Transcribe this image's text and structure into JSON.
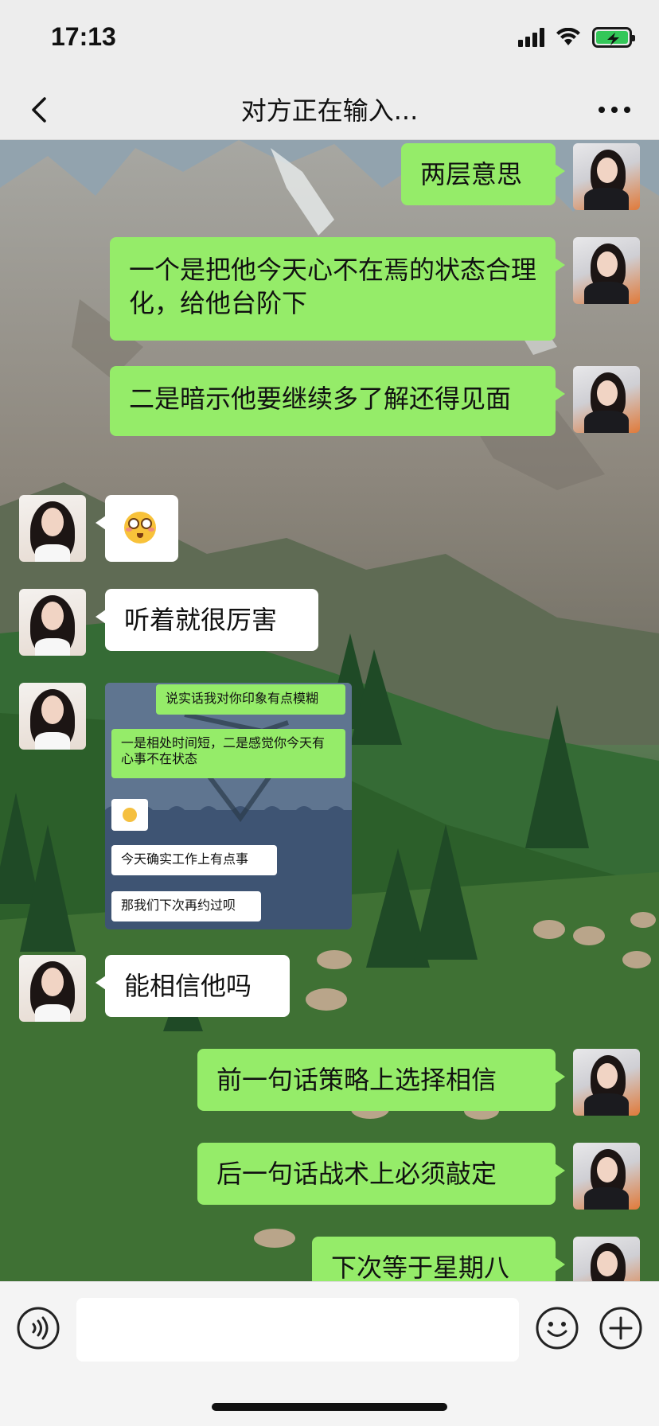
{
  "status_bar": {
    "time": "17:13",
    "icons": [
      "signal-icon",
      "wifi-icon",
      "battery-charging-icon"
    ],
    "battery_color": "#34c759"
  },
  "nav": {
    "back_icon": "chevron-left-icon",
    "title": "对方正在输入...",
    "more_icon": "more-dots-icon"
  },
  "colors": {
    "outgoing_bubble": "#95ec69",
    "incoming_bubble": "#ffffff",
    "bar_background": "#ededed"
  },
  "messages": [
    {
      "direction": "out",
      "type": "text",
      "text": "两层意思"
    },
    {
      "direction": "out",
      "type": "text",
      "text": "一个是把他今天心不在焉的状态合理化，给他台阶下"
    },
    {
      "direction": "out",
      "type": "text",
      "text": "二是暗示他要继续多了解还得见面"
    },
    {
      "direction": "in",
      "type": "emoji",
      "emoji": "pleading-face-emoji"
    },
    {
      "direction": "in",
      "type": "text",
      "text": "听着就很厉害"
    },
    {
      "direction": "in",
      "type": "image",
      "embedded": {
        "bubbles": [
          {
            "side": "right",
            "text": "说实话我对你印象有点模糊"
          },
          {
            "side": "right",
            "text": "一是相处时间短，二是感觉你今天有心事不在状态"
          },
          {
            "side": "left",
            "emoji": "sweat-smile-emoji"
          },
          {
            "side": "left",
            "text": "今天确实工作上有点事"
          },
          {
            "side": "left",
            "text": "那我们下次再约过呗"
          }
        ]
      }
    },
    {
      "direction": "in",
      "type": "text",
      "text": "能相信他吗"
    },
    {
      "direction": "out",
      "type": "text",
      "text": "前一句话策略上选择相信"
    },
    {
      "direction": "out",
      "type": "text",
      "text": "后一句话战术上必须敲定"
    },
    {
      "direction": "out",
      "type": "text",
      "text": "下次等于星期八"
    }
  ],
  "input_bar": {
    "voice_icon": "voice-icon",
    "input_value": "",
    "emoji_icon": "emoji-icon",
    "plus_icon": "plus-circle-icon"
  }
}
